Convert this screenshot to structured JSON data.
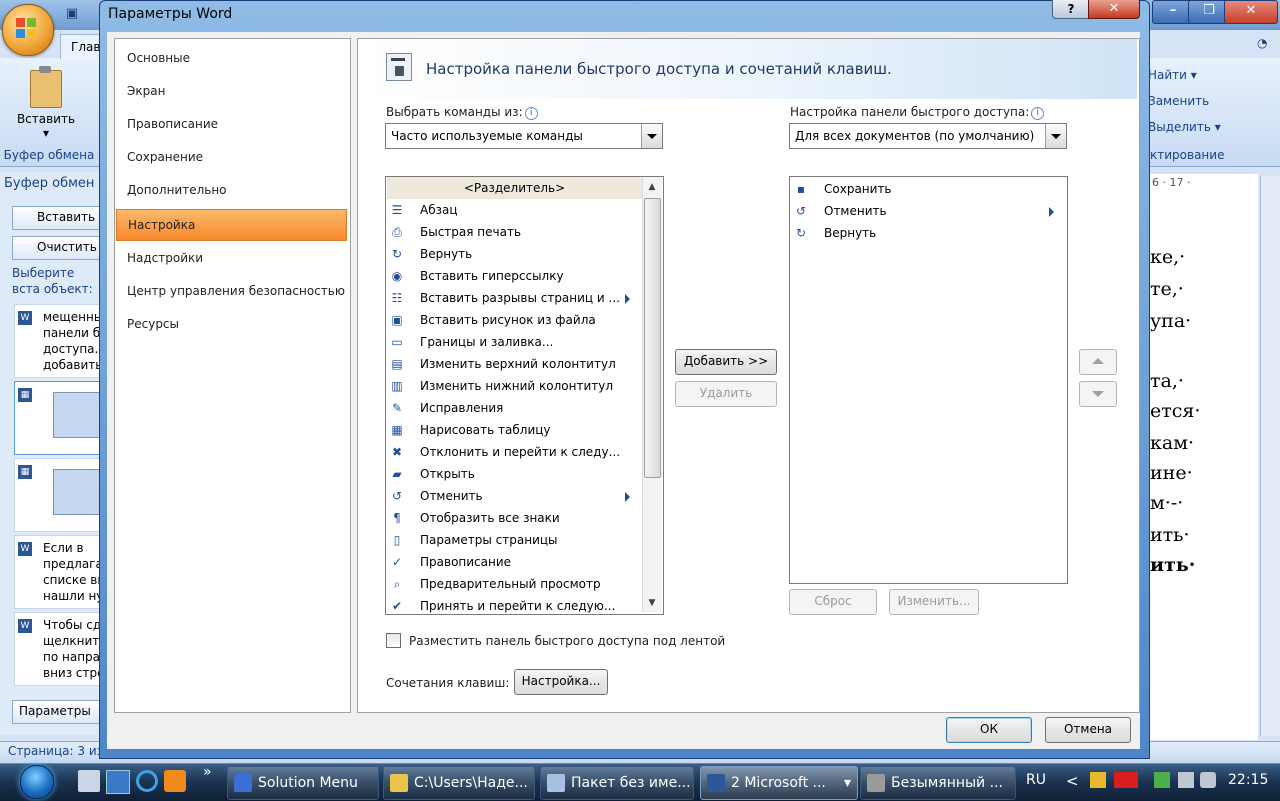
{
  "background_app": {
    "ribbon": {
      "home_tab": "Глав",
      "paste": "Вставить",
      "paste_arrow": "▾",
      "clipboard_group": "Буфер обмена",
      "find": "Найти ▾",
      "replace": "Заменить",
      "select": "Выделить ▾",
      "editing_group": "ктирование"
    },
    "clipboard_pane": {
      "title": "Буфер обмен",
      "paste_all": "Вставить в",
      "clear_all": "Очистить",
      "hint": "Выберите вста объект:",
      "items": [
        {
          "lines": [
            "мещенны",
            "панели б",
            "доступа.",
            "добавить"
          ]
        },
        {
          "lines": []
        },
        {
          "lines": []
        },
        {
          "lines": [
            "Если в",
            "предлага",
            "списке вы",
            "нашли ну"
          ]
        },
        {
          "lines": [
            "Чтобы сд",
            "щелкните",
            "по напра",
            "вниз стре"
          ]
        }
      ],
      "options": "Параметры"
    },
    "ruler": "6 · 17 ·",
    "document_lines": [
      "ке,·",
      "те,·",
      "упа·",
      "та,·",
      "ется·",
      "кам·",
      "ине·",
      "м·-·",
      "ить·",
      "ить·"
    ],
    "status_page": "Страница: 3 из",
    "window_controls": [
      "–",
      "❐",
      "✕"
    ]
  },
  "dialog": {
    "title": "Параметры Word",
    "help_button": "?",
    "close_button": "✕",
    "nav": [
      "Основные",
      "Экран",
      "Правописание",
      "Сохранение",
      "Дополнительно",
      "Настройка",
      "Надстройки",
      "Центр управления безопасностью",
      "Ресурсы"
    ],
    "selected_nav": "Настройка",
    "header_title": "Настройка панели быстрого доступа и сочетаний клавиш.",
    "choose_commands_label": "Выбрать команды из:",
    "choose_commands_value": "Часто используемые команды",
    "qat_label": "Настройка панели быстрого доступа:",
    "qat_value": "Для всех документов (по умолчанию)",
    "commands": [
      {
        "label": "<Разделитель>",
        "icon": "separator",
        "selected": true
      },
      {
        "label": "Абзац",
        "icon": "paragraph-icon"
      },
      {
        "label": "Быстрая печать",
        "icon": "print-icon"
      },
      {
        "label": "Вернуть",
        "icon": "redo-icon"
      },
      {
        "label": "Вставить гиперссылку",
        "icon": "hyperlink-icon"
      },
      {
        "label": "Вставить разрывы страниц и ...",
        "icon": "page-break-icon",
        "submenu": true
      },
      {
        "label": "Вставить рисунок из файла",
        "icon": "picture-icon"
      },
      {
        "label": "Границы и заливка...",
        "icon": "borders-icon"
      },
      {
        "label": "Изменить верхний колонтитул",
        "icon": "header-icon"
      },
      {
        "label": "Изменить нижний колонтитул",
        "icon": "footer-icon"
      },
      {
        "label": "Исправления",
        "icon": "track-changes-icon"
      },
      {
        "label": "Нарисовать таблицу",
        "icon": "draw-table-icon"
      },
      {
        "label": "Отклонить и перейти к следу...",
        "icon": "reject-icon"
      },
      {
        "label": "Открыть",
        "icon": "open-folder-icon"
      },
      {
        "label": "Отменить",
        "icon": "undo-icon",
        "submenu": true
      },
      {
        "label": "Отобразить все знаки",
        "icon": "pilcrow-icon"
      },
      {
        "label": "Параметры страницы",
        "icon": "page-setup-icon"
      },
      {
        "label": "Правописание",
        "icon": "spelling-icon"
      },
      {
        "label": "Предварительный просмотр",
        "icon": "print-preview-icon"
      },
      {
        "label": "Принять и перейти к следую...",
        "icon": "accept-icon"
      }
    ],
    "qat_items": [
      {
        "label": "Сохранить",
        "icon": "save-icon"
      },
      {
        "label": "Отменить",
        "icon": "undo-icon",
        "submenu": true
      },
      {
        "label": "Вернуть",
        "icon": "redo-icon"
      }
    ],
    "add_button": "Добавить >>",
    "remove_button": "Удалить",
    "reset_button": "Сброс",
    "modify_button": "Изменить...",
    "below_ribbon_checkbox": "Разместить панель быстрого доступа под лентой",
    "below_ribbon_checked": false,
    "shortcuts_label": "Сочетания клавиш:",
    "shortcuts_button": "Настройка...",
    "ok_button": "ОК",
    "cancel_button": "Отмена"
  },
  "taskbar": {
    "buttons": [
      {
        "label": "Solution Menu",
        "icon_color": "#3c6fd6"
      },
      {
        "label": "C:\\Users\\Наде...",
        "icon_color": "#e8c44a"
      },
      {
        "label": "Пакет без име...",
        "icon_color": "#a7c0e2"
      },
      {
        "label": "2 Microsoft ...",
        "icon_color": "#2b5797",
        "active": true,
        "dropdown": "▾"
      },
      {
        "label": "Безымянный ...",
        "icon_color": "#9a9a9a"
      }
    ],
    "quick_launch_more": "»",
    "language": "RU",
    "tray_chevron": "<",
    "clock": "22:15"
  }
}
